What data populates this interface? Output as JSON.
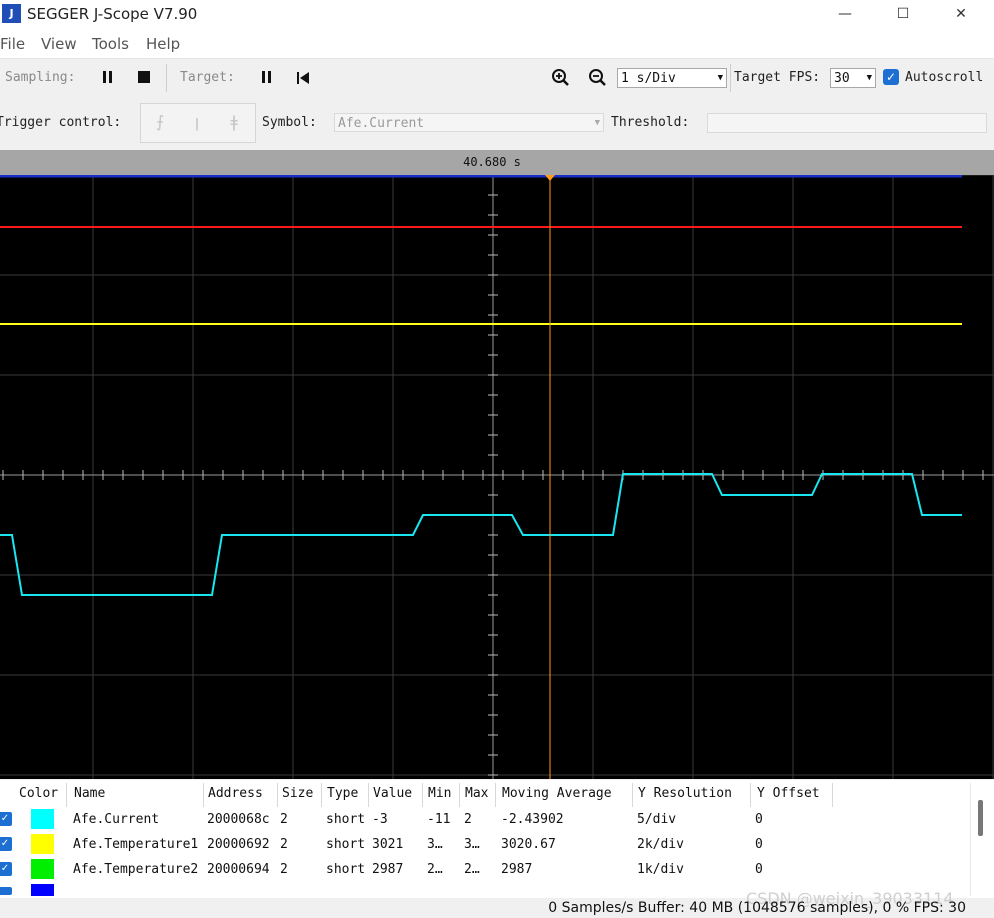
{
  "window": {
    "title": "SEGGER J-Scope V7.90",
    "icon_label": "J",
    "controls": {
      "minimize": "—",
      "maximize": "☐",
      "close": "✕"
    }
  },
  "menu": [
    "File",
    "View",
    "Tools",
    "Help"
  ],
  "toolbar": {
    "sampling_label": "Sampling:",
    "target_label": "Target:",
    "time_per_div": "1 s/Div",
    "target_fps_label": "Target FPS:",
    "target_fps": "30",
    "autoscroll_label": "Autoscroll",
    "autoscroll_checked": true
  },
  "trigger": {
    "label": "Trigger control:",
    "buttons": [
      "rising-edge",
      "falling-edge",
      "both-edges"
    ],
    "symbol_label": "Symbol:",
    "symbol_value": "Afe.Current",
    "threshold_label": "Threshold:",
    "threshold_value": ""
  },
  "scope": {
    "time_readout": "40.680 s",
    "background": "#000000",
    "cursor_color": "#ff9a1a"
  },
  "table": {
    "columns": [
      "Color",
      "Name",
      "Address",
      "Size",
      "Type",
      "Value",
      "Min",
      "Max",
      "Moving Average",
      "Y Resolution",
      "Y Offset"
    ],
    "rows": [
      {
        "color": "#00ffff",
        "name": "Afe.Current",
        "address": "2000068c",
        "size": "2",
        "type": "short",
        "value": "-3",
        "min": "-11",
        "max": "2",
        "moving_average": "-2.43902",
        "y_resolution": "5/div",
        "y_offset": "0"
      },
      {
        "color": "#ffff00",
        "name": "Afe.Temperature1",
        "address": "20000692",
        "size": "2",
        "type": "short",
        "value": "3021",
        "min": "3…",
        "max": "3…",
        "moving_average": "3020.67",
        "y_resolution": "2k/div",
        "y_offset": "0"
      },
      {
        "color": "#00ee00",
        "name": "Afe.Temperature2",
        "address": "20000694",
        "size": "2",
        "type": "short",
        "value": "2987",
        "min": "2…",
        "max": "2…",
        "moving_average": "2987",
        "y_resolution": "1k/div",
        "y_offset": "0"
      },
      {
        "color": "#0000ff"
      }
    ]
  },
  "status": "0 Samples/s Buffer: 40 MB (1048576 samples), 0 % FPS: 30",
  "watermark": "CSDN @weixin_39033114"
}
